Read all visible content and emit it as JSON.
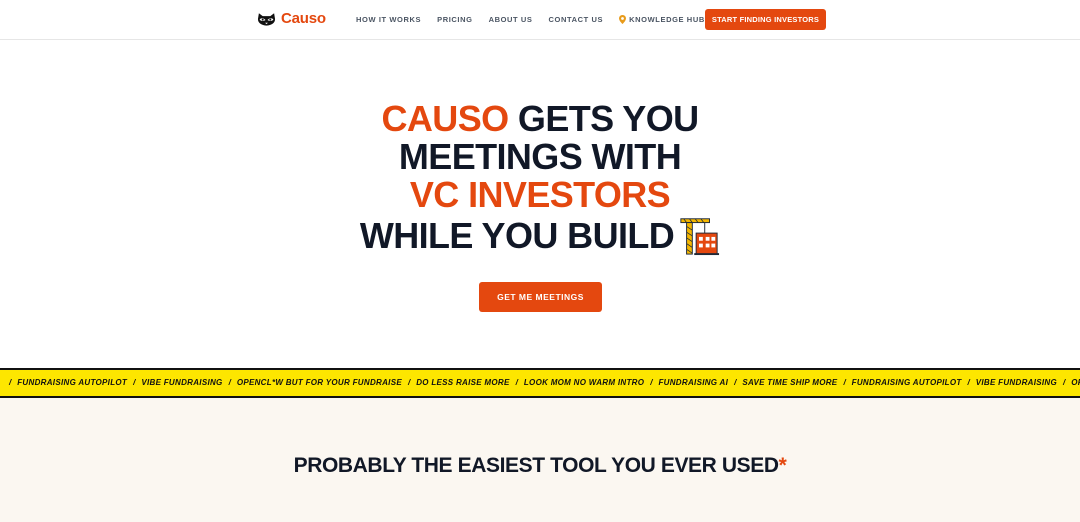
{
  "brand": {
    "name": "Causo",
    "icon": "raccoon-icon",
    "color": "#e4480f"
  },
  "nav": {
    "items": [
      {
        "label": "HOW IT WORKS"
      },
      {
        "label": "PRICING"
      },
      {
        "label": "ABOUT US"
      },
      {
        "label": "CONTACT US"
      },
      {
        "label": "KNOWLEDGE HUB",
        "icon": "pin-icon"
      }
    ],
    "cta": "START FINDING INVESTORS"
  },
  "hero": {
    "line1_highlight": "CAUSO",
    "line1_rest": " GETS YOU",
    "line2": "MEETINGS WITH",
    "line3": "VC INVESTORS",
    "line4": "WHILE YOU BUILD",
    "emoji": "crane-icon",
    "cta": "GET ME MEETINGS"
  },
  "ticker": {
    "background": "#fde600",
    "items": [
      "FUNDRAISING AUTOPILOT",
      "VIBE FUNDRAISING",
      "OPENCL*W BUT FOR YOUR FUNDRAISE",
      "DO LESS RAISE MORE",
      "LOOK MOM NO WARM INTRO",
      "FUNDRAISING AI",
      "SAVE TIME SHIP MORE",
      "FUNDRAISING AUTOPILOT",
      "VIBE FUNDRAISING",
      "OPENCL*W BUT FOR YOUR FUNDRAISE"
    ]
  },
  "section": {
    "title": "PROBABLY THE EASIEST TOOL YOU EVER USED",
    "mark": "*"
  }
}
